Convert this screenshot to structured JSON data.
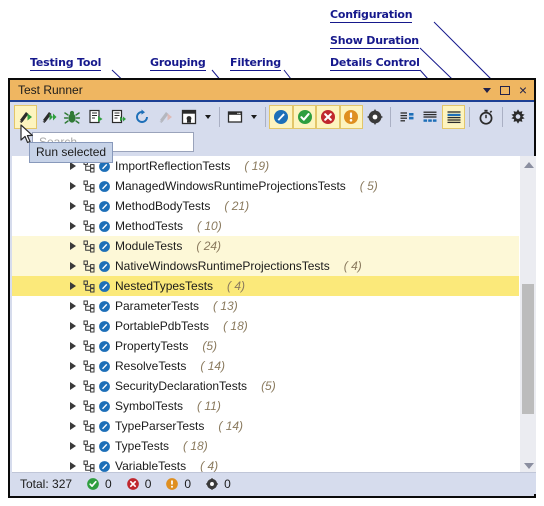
{
  "annotations": [
    {
      "id": "testing-tool",
      "label": "Testing Tool"
    },
    {
      "id": "grouping",
      "label": "Grouping"
    },
    {
      "id": "filtering",
      "label": "Filtering"
    },
    {
      "id": "details-control",
      "label": "Details Control"
    },
    {
      "id": "show-duration",
      "label": "Show Duration"
    },
    {
      "id": "configuration",
      "label": "Configuration"
    }
  ],
  "window": {
    "title": "Test Runner",
    "title_bg": "#efb661",
    "chrome_buttons": [
      {
        "name": "window-menu-button",
        "glyph": "caret-down"
      },
      {
        "name": "restore-button",
        "glyph": "restore"
      },
      {
        "name": "close-button",
        "glyph": "×"
      }
    ]
  },
  "toolbar": {
    "groups": [
      {
        "name": "testing-tool",
        "items": [
          {
            "name": "run-selected-button",
            "icon": "run-selected-icon",
            "state": "active"
          },
          {
            "name": "run-all-button",
            "icon": "run-all-icon",
            "state": "normal"
          },
          {
            "name": "debug-button",
            "icon": "bug-icon",
            "state": "normal"
          },
          {
            "name": "run-file-button",
            "icon": "run-file-icon",
            "state": "normal"
          },
          {
            "name": "run-file-all-button",
            "icon": "run-file-all-icon",
            "state": "normal"
          },
          {
            "name": "repeat-button",
            "icon": "repeat-icon",
            "state": "normal"
          },
          {
            "name": "run-until-fail-button",
            "icon": "run-disabled-icon",
            "state": "disabled"
          },
          {
            "name": "export-button",
            "icon": "export-icon",
            "state": "normal",
            "dropdown": true
          }
        ]
      },
      {
        "name": "grouping",
        "items": [
          {
            "name": "grouping-button",
            "icon": "window-group-icon",
            "state": "normal",
            "dropdown": true
          }
        ]
      },
      {
        "name": "filtering",
        "items": [
          {
            "name": "filter-not-run-button",
            "icon": "not-run-icon",
            "state": "active"
          },
          {
            "name": "filter-passed-button",
            "icon": "passed-icon",
            "state": "active"
          },
          {
            "name": "filter-failed-button",
            "icon": "failed-icon",
            "state": "active"
          },
          {
            "name": "filter-warning-button",
            "icon": "warning-icon",
            "state": "active"
          },
          {
            "name": "filter-ignored-button",
            "icon": "ignored-icon",
            "state": "normal"
          }
        ]
      },
      {
        "name": "details-control",
        "items": [
          {
            "name": "details-right-button",
            "icon": "details-right-icon",
            "state": "normal"
          },
          {
            "name": "details-bottom-button",
            "icon": "details-bottom-icon",
            "state": "normal"
          },
          {
            "name": "details-off-button",
            "icon": "details-off-icon",
            "state": "active"
          }
        ]
      },
      {
        "name": "show-duration",
        "items": [
          {
            "name": "show-duration-button",
            "icon": "stopwatch-icon",
            "state": "normal"
          }
        ]
      },
      {
        "name": "configuration",
        "items": [
          {
            "name": "configuration-button",
            "icon": "gear-icon",
            "state": "normal"
          }
        ]
      }
    ]
  },
  "search": {
    "value": "",
    "placeholder": "Search"
  },
  "tooltip": {
    "text": "Run selected"
  },
  "tree": {
    "rows": [
      {
        "name": "ImportReflectionTests",
        "count": "( 19)",
        "state": "normal",
        "clipped": true
      },
      {
        "name": "ManagedWindowsRuntimeProjectionsTests",
        "count": "( 5)",
        "state": "normal"
      },
      {
        "name": "MethodBodyTests",
        "count": "( 21)",
        "state": "normal"
      },
      {
        "name": "MethodTests",
        "count": "( 10)",
        "state": "normal"
      },
      {
        "name": "ModuleTests",
        "count": "( 24)",
        "state": "highlight"
      },
      {
        "name": "NativeWindowsRuntimeProjectionsTests",
        "count": "( 4)",
        "state": "highlight"
      },
      {
        "name": "NestedTypesTests",
        "count": "( 4)",
        "state": "selected"
      },
      {
        "name": "ParameterTests",
        "count": "( 13)",
        "state": "normal"
      },
      {
        "name": "PortablePdbTests",
        "count": "( 18)",
        "state": "normal"
      },
      {
        "name": "PropertyTests",
        "count": "(5)",
        "state": "normal"
      },
      {
        "name": "ResolveTests",
        "count": "( 14)",
        "state": "normal"
      },
      {
        "name": "SecurityDeclarationTests",
        "count": "(5)",
        "state": "normal"
      },
      {
        "name": "SymbolTests",
        "count": "( 11)",
        "state": "normal"
      },
      {
        "name": "TypeParserTests",
        "count": "( 14)",
        "state": "normal"
      },
      {
        "name": "TypeTests",
        "count": "( 18)",
        "state": "normal"
      },
      {
        "name": "VariableTests",
        "count": "( 4)",
        "state": "normal"
      }
    ]
  },
  "status": {
    "total_label": "Total: 327",
    "counters": [
      {
        "name": "passed-count",
        "icon": "passed-icon",
        "value": "0"
      },
      {
        "name": "failed-count",
        "icon": "failed-icon",
        "value": "0"
      },
      {
        "name": "warning-count",
        "icon": "warning-icon",
        "value": "0"
      },
      {
        "name": "ignored-count",
        "icon": "ignored-icon",
        "value": "0"
      }
    ]
  },
  "colors": {
    "accent_blue": "#1d6fb8",
    "pass_green": "#2f9e3f",
    "fail_red": "#c0272d",
    "warn_orange": "#df8f20",
    "title_orange": "#efb661",
    "selection_yellow": "#fbe97a",
    "highlight_yellow": "#fdf8d7",
    "annotation_blue": "#16198c"
  }
}
